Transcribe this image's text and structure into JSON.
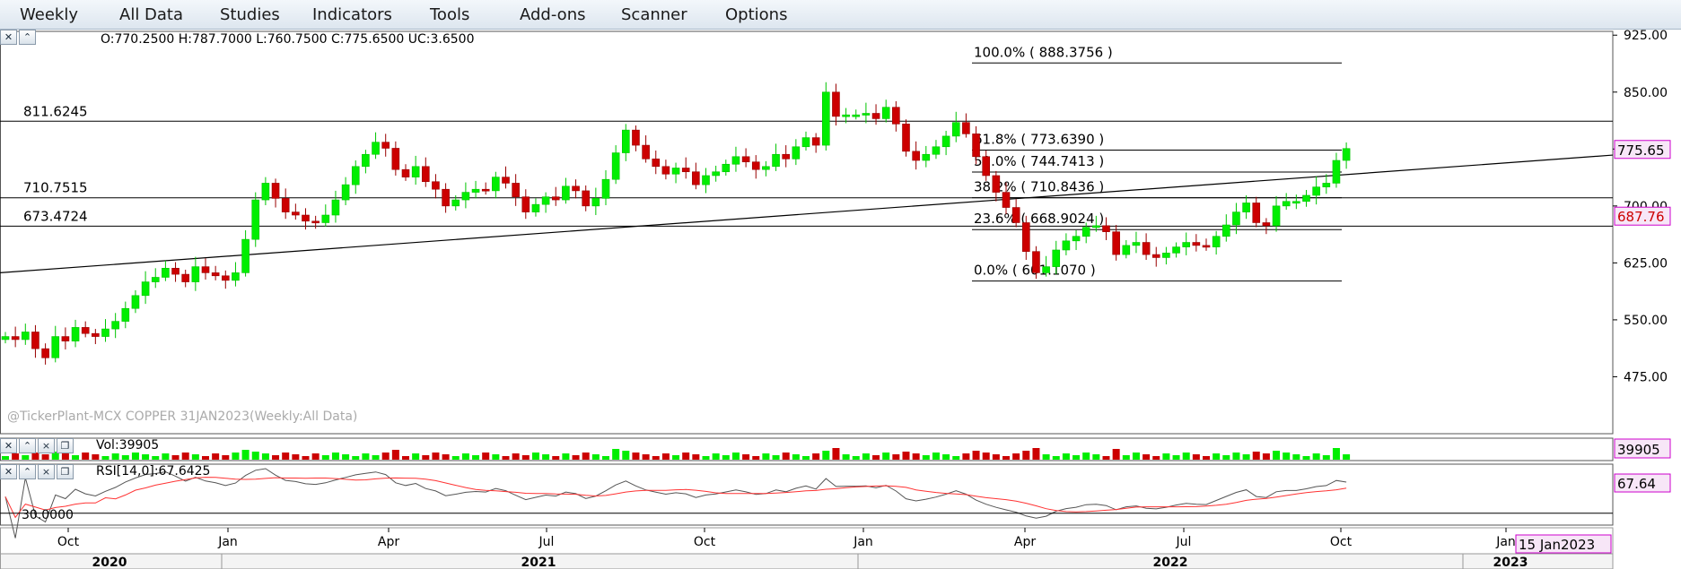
{
  "menu": {
    "items": [
      "Weekly",
      "All Data",
      "Studies",
      "Indicators",
      "Tools",
      "Add-ons",
      "Scanner",
      "Options"
    ]
  },
  "main_panel": {
    "ohlc_info": "O:770.2500  H:787.7000  L:760.7500  C:775.6500  UC:3.6500",
    "watermark": "@TickerPlant-MCX COPPER 31JAN2023(Weekly:All Data)",
    "last_price_badge": "775.65",
    "ref_price_badge": "687.76"
  },
  "volume_panel": {
    "label": "Vol:39905",
    "badge": "39905"
  },
  "rsi_panel": {
    "label": "RSI[14,0]:67.6425",
    "badge": "67.64",
    "level_label": "30.0000"
  },
  "date_badge": "15 Jan2023",
  "colors": {
    "up": "#00ee00",
    "down": "#cc0000",
    "badge_border": "#cc00cc",
    "badge_bg": "#f7e6f7"
  },
  "chart_data": {
    "type": "candlestick",
    "x_tick_labels": [
      "Oct",
      "Jan",
      "Apr",
      "Jul",
      "Oct",
      "Jan",
      "Apr",
      "Jul",
      "Oct",
      "Jan"
    ],
    "year_labels": [
      "2020",
      "2021",
      "2022",
      "2023"
    ],
    "y_tick_labels": [
      "925.00",
      "850.00",
      "775.00",
      "700.00",
      "625.00",
      "550.00",
      "475.00"
    ],
    "ylim": [
      400,
      930
    ],
    "horizontal_lines": [
      {
        "label": "811.6245",
        "value": 811.6245
      },
      {
        "label": "710.7515",
        "value": 710.7515
      },
      {
        "label": "673.4724",
        "value": 673.4724
      }
    ],
    "fibonacci": [
      {
        "label": "100.0% ( 888.3756 )",
        "value": 888.3756
      },
      {
        "label": "61.8% ( 773.6390 )",
        "value": 773.639
      },
      {
        "label": "50.0% ( 744.7413 )",
        "value": 744.7413
      },
      {
        "label": "38.2% ( 710.8436 )",
        "value": 710.8436
      },
      {
        "label": "23.6% ( 668.9024 )",
        "value": 668.9024
      },
      {
        "label": "0.0% ( 601.1070 )",
        "value": 601.107
      }
    ],
    "trendline": {
      "start_value": 612,
      "end_value": 767
    },
    "closes": [
      528,
      524,
      534,
      512,
      500,
      528,
      522,
      540,
      532,
      528,
      538,
      548,
      565,
      582,
      600,
      606,
      618,
      610,
      600,
      620,
      612,
      608,
      602,
      612,
      656,
      708,
      730,
      710,
      692,
      688,
      680,
      678,
      688,
      708,
      728,
      752,
      768,
      784,
      776,
      748,
      738,
      752,
      732,
      722,
      700,
      708,
      718,
      722,
      720,
      738,
      730,
      712,
      692,
      702,
      712,
      708,
      726,
      720,
      700,
      710,
      735,
      770,
      800,
      780,
      762,
      752,
      742,
      750,
      745,
      728,
      740,
      745,
      755,
      765,
      758,
      748,
      752,
      768,
      762,
      778,
      790,
      780,
      850,
      818,
      820,
      820,
      822,
      815,
      830,
      808,
      772,
      760,
      768,
      778,
      792,
      810,
      795,
      765,
      740,
      718,
      698,
      678,
      640,
      612,
      620,
      642,
      654,
      660,
      672,
      674,
      666,
      636,
      648,
      652,
      636,
      632,
      638,
      646,
      652,
      648,
      646,
      660,
      675,
      692,
      704,
      678,
      674,
      700,
      706,
      706,
      714,
      725,
      730,
      760,
      775.65
    ],
    "volume_value": 39905,
    "rsi_last": 67.6425,
    "rsi_level": 30
  }
}
